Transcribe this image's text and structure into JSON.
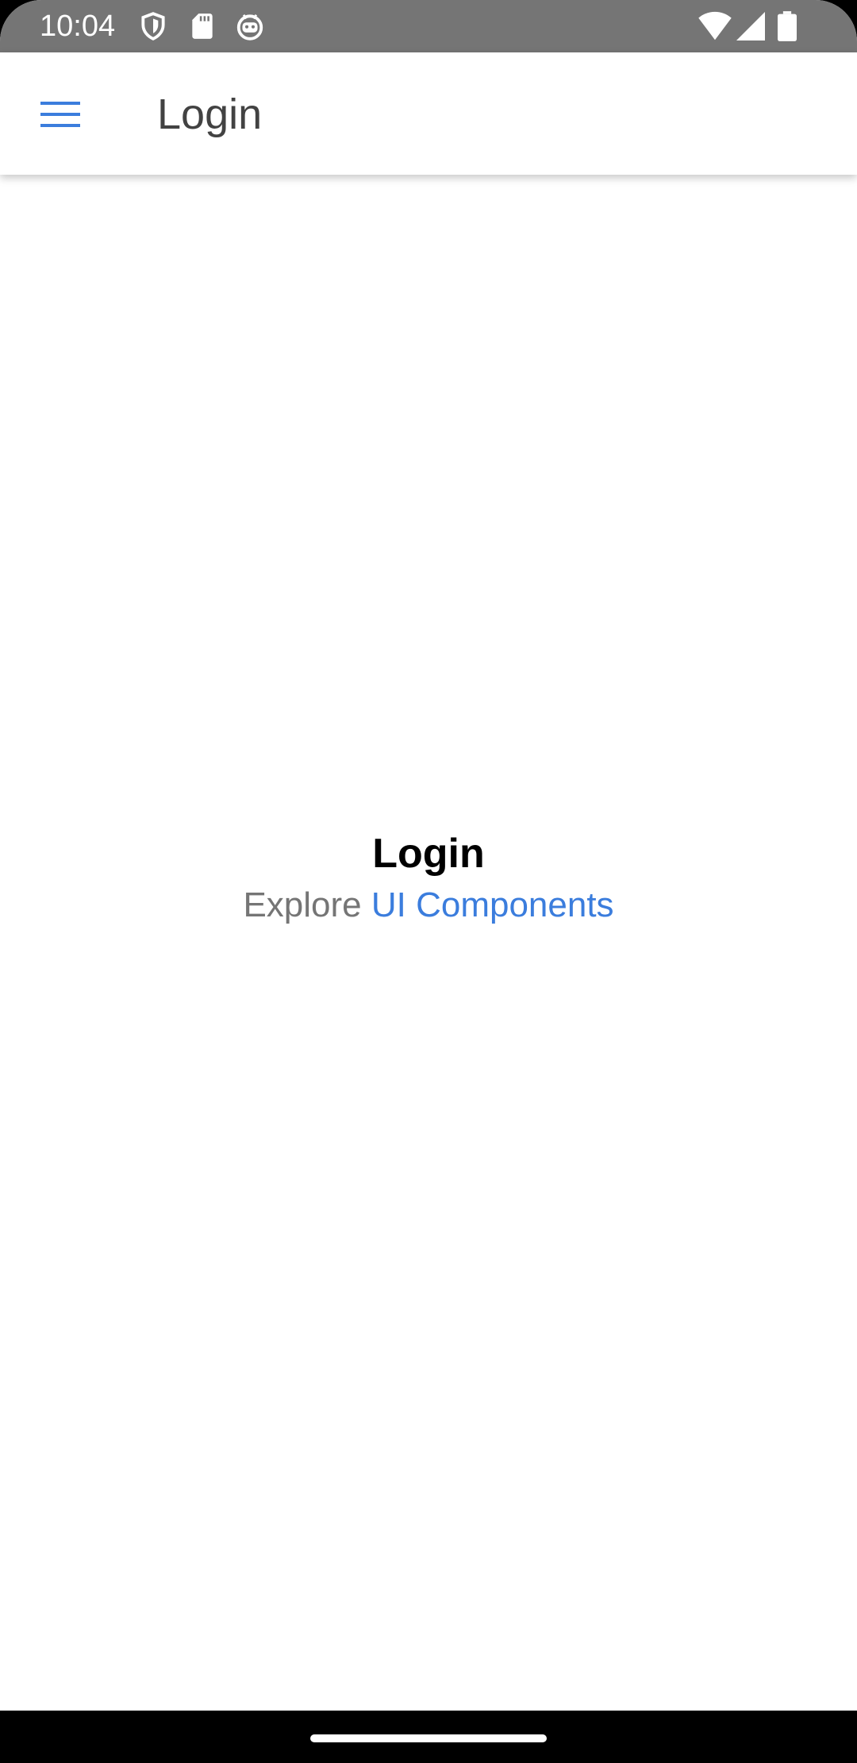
{
  "status_bar": {
    "time": "10:04",
    "icons_left": [
      "shield-icon",
      "sd-card-icon",
      "android-face-icon"
    ],
    "icons_right": [
      "wifi-icon",
      "signal-icon",
      "battery-icon"
    ]
  },
  "app_bar": {
    "menu_icon": "hamburger-menu-icon",
    "title": "Login",
    "accent_color": "#3b7ddd"
  },
  "content": {
    "title": "Login",
    "explore_text": "Explore",
    "link_text": "UI Components"
  },
  "colors": {
    "status_bar": "#757575",
    "title_text": "#424242",
    "link": "#3b7ddd",
    "muted_text": "#757575"
  }
}
